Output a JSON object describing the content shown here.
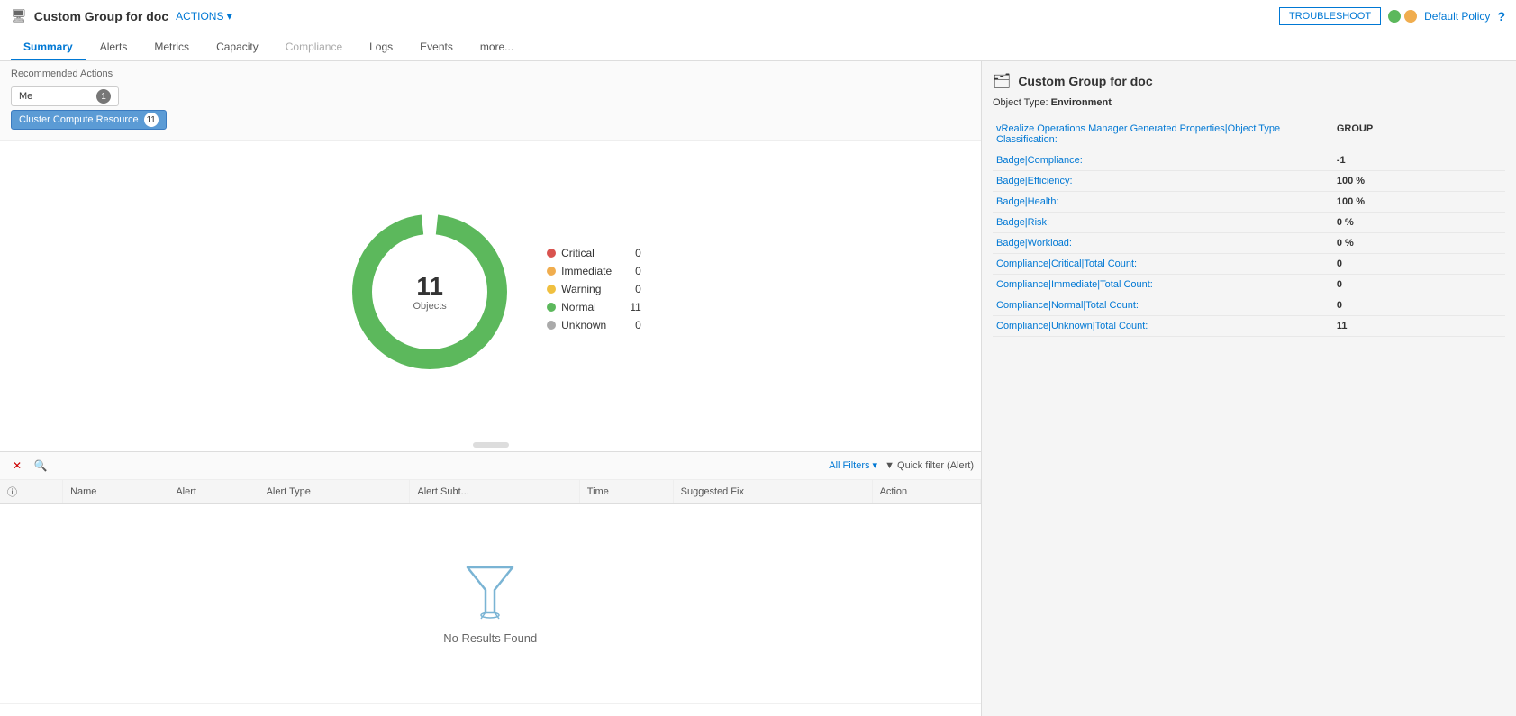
{
  "header": {
    "page_icon": "🖥",
    "title": "Custom Group for doc",
    "actions_label": "ACTIONS ▾",
    "troubleshoot_label": "TROUBLESHOOT",
    "default_policy_label": "Default Policy",
    "help_label": "?"
  },
  "tabs": [
    {
      "id": "summary",
      "label": "Summary",
      "active": true,
      "disabled": false
    },
    {
      "id": "alerts",
      "label": "Alerts",
      "active": false,
      "disabled": false
    },
    {
      "id": "metrics",
      "label": "Metrics",
      "active": false,
      "disabled": false
    },
    {
      "id": "capacity",
      "label": "Capacity",
      "active": false,
      "disabled": false
    },
    {
      "id": "compliance",
      "label": "Compliance",
      "active": false,
      "disabled": true
    },
    {
      "id": "logs",
      "label": "Logs",
      "active": false,
      "disabled": false
    },
    {
      "id": "events",
      "label": "Events",
      "active": false,
      "disabled": false
    },
    {
      "id": "more",
      "label": "more...",
      "active": false,
      "disabled": false
    }
  ],
  "recommended_actions": {
    "title": "Recommended Actions",
    "filters": [
      {
        "label": "Me",
        "count": 1,
        "active": false
      },
      {
        "label": "Cluster Compute Resource",
        "count": 11,
        "active": true
      }
    ]
  },
  "donut": {
    "total": 11,
    "label": "Objects",
    "segments": [
      {
        "name": "Critical",
        "value": 0,
        "color": "#d9534f"
      },
      {
        "name": "Immediate",
        "value": 0,
        "color": "#f0ad4e"
      },
      {
        "name": "Warning",
        "value": 0,
        "color": "#f0c040"
      },
      {
        "name": "Normal",
        "value": 11,
        "color": "#5cb85c"
      },
      {
        "name": "Unknown",
        "value": 0,
        "color": "#aaa"
      }
    ]
  },
  "bottom_toolbar": {
    "all_filters_label": "All Filters ▾",
    "quick_filter_label": "▼ Quick filter (Alert)"
  },
  "table": {
    "columns": [
      "",
      "Name",
      "Alert",
      "Alert Type",
      "Alert Subt...",
      "Time",
      "Suggested Fix",
      "Action"
    ]
  },
  "no_results": {
    "text": "No Results Found"
  },
  "right_panel": {
    "title": "Custom Group for doc",
    "object_type_label": "Object Type:",
    "object_type_value": "Environment",
    "properties": [
      {
        "key": "vRealize Operations Manager Generated Properties|Object Type Classification:",
        "value": "GROUP"
      },
      {
        "key": "Badge|Compliance:",
        "value": "-1"
      },
      {
        "key": "Badge|Efficiency:",
        "value": "100 %"
      },
      {
        "key": "Badge|Health:",
        "value": "100 %"
      },
      {
        "key": "Badge|Risk:",
        "value": "0 %"
      },
      {
        "key": "Badge|Workload:",
        "value": "0 %"
      },
      {
        "key": "Compliance|Critical|Total Count:",
        "value": "0"
      },
      {
        "key": "Compliance|Immediate|Total Count:",
        "value": "0"
      },
      {
        "key": "Compliance|Normal|Total Count:",
        "value": "0"
      },
      {
        "key": "Compliance|Unknown|Total Count:",
        "value": "11"
      }
    ]
  }
}
